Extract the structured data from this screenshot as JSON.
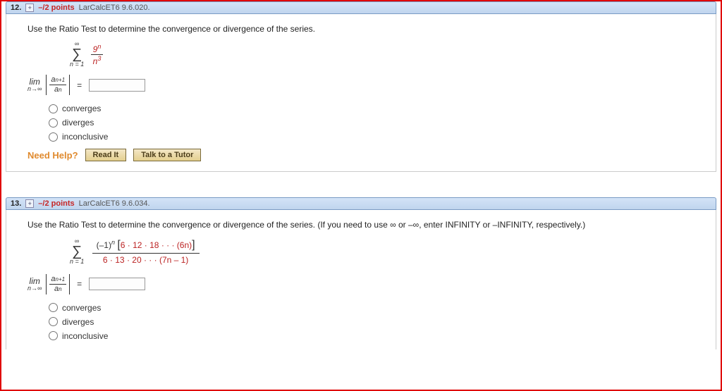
{
  "questions": [
    {
      "number": "12.",
      "points": "–/2 points",
      "source": "LarCalcET6 9.6.020.",
      "prompt": "Use the Ratio Test to determine the convergence or divergence of the series.",
      "series": {
        "upper": "∞",
        "lower": "n = 1",
        "num": "9",
        "num_sup": "n",
        "den": "n",
        "den_sup": "3"
      },
      "limit": {
        "lim": "lim",
        "sub": "n→∞",
        "ratio_num": "a",
        "ratio_num_sub": "n+1",
        "ratio_den": "a",
        "ratio_den_sub": "n",
        "eq": "="
      },
      "options": [
        "converges",
        "diverges",
        "inconclusive"
      ],
      "help_label": "Need Help?",
      "help_read": "Read It",
      "help_tutor": "Talk to a Tutor"
    },
    {
      "number": "13.",
      "points": "–/2 points",
      "source": "LarCalcET6 9.6.034.",
      "prompt": "Use the Ratio Test to determine the convergence or divergence of the series. (If you need to use ∞ or –∞, enter INFINITY or –INFINITY, respectively.)",
      "series": {
        "upper": "∞",
        "lower": "n = 1",
        "bnum_prefix": "(–1)",
        "bnum_sup": "n",
        "bnum_bracket": "6 · 12 · 18 · · · (6n)",
        "bden": "6 · 13 · 20 · · · (7n – 1)"
      },
      "limit": {
        "lim": "lim",
        "sub": "n→∞",
        "ratio_num": "a",
        "ratio_num_sub": "n+1",
        "ratio_den": "a",
        "ratio_den_sub": "n",
        "eq": "="
      },
      "options": [
        "converges",
        "diverges",
        "inconclusive"
      ]
    }
  ]
}
